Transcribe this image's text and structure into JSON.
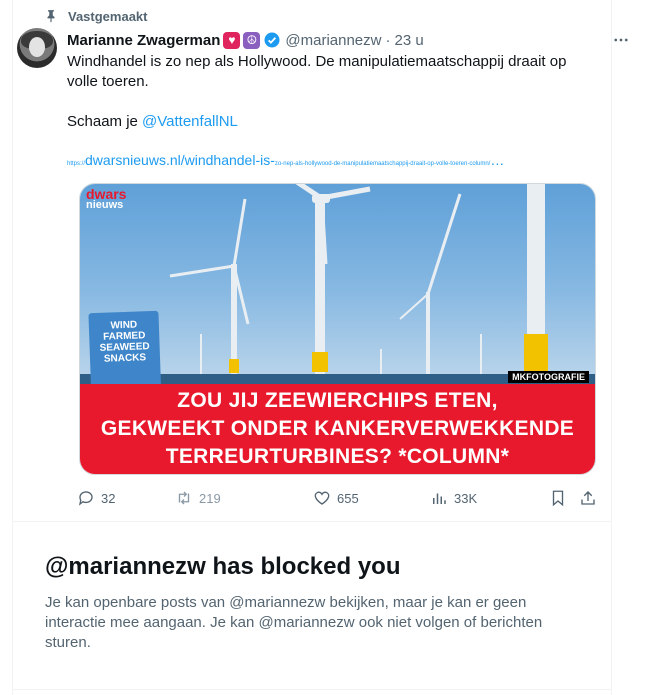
{
  "pinned": {
    "label": "Vastgemaakt",
    "icon": "pin-icon"
  },
  "author": {
    "name": "Marianne Zwagerman",
    "badges": [
      "heart-badge",
      "peace-badge"
    ],
    "handle": "@mariannezw",
    "separator": "·",
    "time": "23 u",
    "verified_icon": "verified-check-icon"
  },
  "tweet": {
    "line1": "Windhandel is zo nep als Hollywood. De manipulatiemaatschappij draait op volle toeren.",
    "line2_prefix": "Schaam je ",
    "mention": "@VattenfallNL",
    "link_prefix": "https://",
    "link_domain": "dwarsnieuws.nl/windhandel-is-",
    "link_rest": "zo-nep-als-hollywood-de-manipulatiemaatschappij-draait-op-volle-toeren-column/",
    "link_ellipsis": "…"
  },
  "media": {
    "logo_top": "dwars",
    "logo_bottom": "nieuws",
    "snack_lines": [
      "WIND",
      "FARMED",
      "SEAWEED",
      "SNACKS"
    ],
    "watermark": "MKFOTOGRAFIE",
    "headline_lines": [
      "ZOU JIJ ZEEWIERCHIPS ETEN,",
      "GEKWEEKT ONDER KANKERVERWEKKENDE",
      "TERREURTURBINES? *COLUMN*"
    ],
    "colors": {
      "banner": "#e8192c",
      "sky": "#6ea9dd",
      "sea": "#2f5f86"
    }
  },
  "actions": {
    "replies": "32",
    "reposts": "219",
    "likes": "655",
    "views": "33K"
  },
  "blocked": {
    "title": "@mariannezw has blocked you",
    "text": "Je kan openbare posts van @mariannezw bekijken, maar je kan er geen interactie mee aangaan. Je kan @mariannezw ook niet volgen of berichten sturen."
  },
  "colors": {
    "accent": "#1d9bf0",
    "muted": "#536471",
    "text": "#0f1419"
  }
}
